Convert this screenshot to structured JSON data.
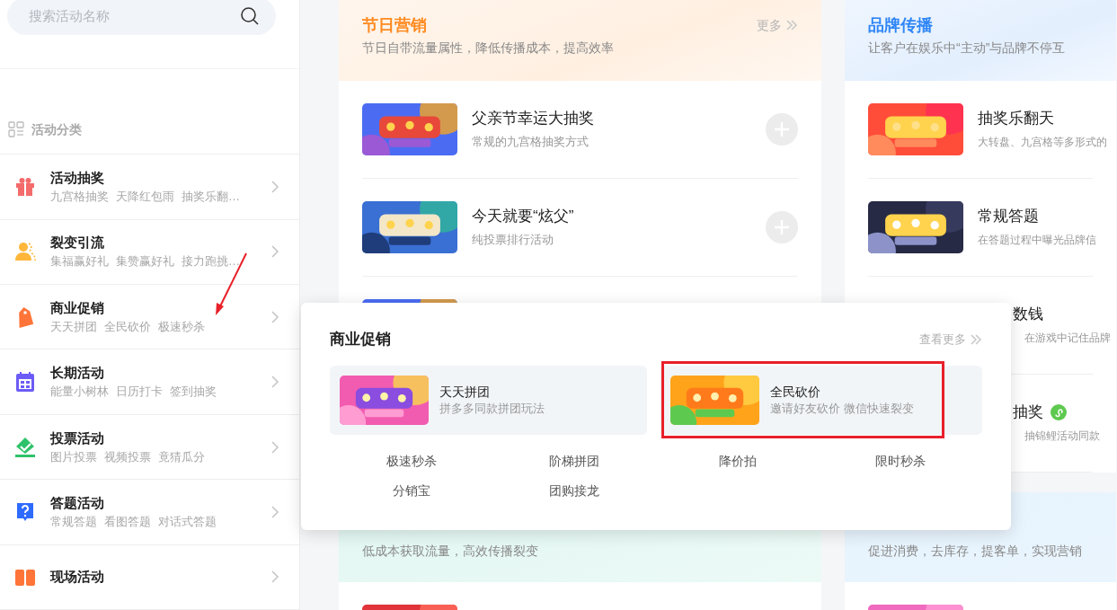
{
  "search": {
    "placeholder": "搜索活动名称"
  },
  "sidebar": {
    "heading": "活动分类",
    "items": [
      {
        "kind": "gift",
        "title": "活动抽奖",
        "tags": [
          "九宫格抽奖",
          "天降红包雨",
          "抽奖乐翻…"
        ]
      },
      {
        "kind": "people",
        "title": "裂变引流",
        "tags": [
          "集福赢好礼",
          "集赞赢好礼",
          "接力跑挑…"
        ]
      },
      {
        "kind": "tag",
        "title": "商业促销",
        "tags": [
          "天天拼团",
          "全民砍价",
          "极速秒杀"
        ]
      },
      {
        "kind": "calendar",
        "title": "长期活动",
        "tags": [
          "能量小树林",
          "日历打卡",
          "签到抽奖"
        ]
      },
      {
        "kind": "vote",
        "title": "投票活动",
        "tags": [
          "图片投票",
          "视频投票",
          "竟猜瓜分"
        ]
      },
      {
        "kind": "question",
        "title": "答题活动",
        "tags": [
          "常规答题",
          "看图答题",
          "对话式答题"
        ]
      },
      {
        "kind": "stage",
        "title": "现场活动"
      }
    ]
  },
  "sections": [
    {
      "title": "节日营销",
      "color": "#ff8a1f",
      "subtitle": "节日自带流量属性，降低传播成本，提高效率",
      "more": "更多",
      "rows": [
        {
          "kind": "full",
          "title": "父亲节幸运大抽奖",
          "desc": "常规的九宫格抽奖方式"
        },
        {
          "kind": "full",
          "title": "今天就要“炫父”",
          "desc": "纯投票排行活动"
        },
        {
          "kind": "hidden"
        }
      ]
    },
    {
      "title": "品牌传播",
      "color": "#2f86f6",
      "subtitle": "让客户在娱乐中“主动”与品牌不停互",
      "rows": [
        {
          "kind": "full",
          "title": "抽奖乐翻天",
          "desc": "大转盘、九宫格等多形式的"
        },
        {
          "kind": "full",
          "title": "常规答题",
          "desc": "在答题过程中曝光品牌信"
        },
        {
          "kind": "covered",
          "title": "数钱",
          "desc": "在游戏中记住品牌"
        },
        {
          "kind": "covered",
          "title": "抽奖",
          "desc": "抽锦鲤活动同款",
          "mini_program": true
        }
      ]
    },
    {
      "subtitle": "低成本获取流量，高效传播裂变",
      "rows": [
        {
          "kind": "cut"
        }
      ]
    },
    {
      "subtitle": "促进消费，去库存，提客单，实现营销",
      "rows": [
        {
          "kind": "cut"
        }
      ]
    }
  ],
  "popup": {
    "title": "商业促销",
    "more": "查看更多",
    "featured": [
      {
        "title": "天天拼团",
        "desc": "拼多多同款拼团玩法",
        "highlighted": false
      },
      {
        "title": "全民砍价",
        "desc": "邀请好友砍价 微信快速裂变",
        "highlighted": true
      }
    ],
    "links": [
      "极速秒杀",
      "阶梯拼团",
      "降价拍",
      "限时秒杀",
      "分销宝",
      "团购接龙"
    ]
  },
  "annotation": {
    "arrow": true
  }
}
